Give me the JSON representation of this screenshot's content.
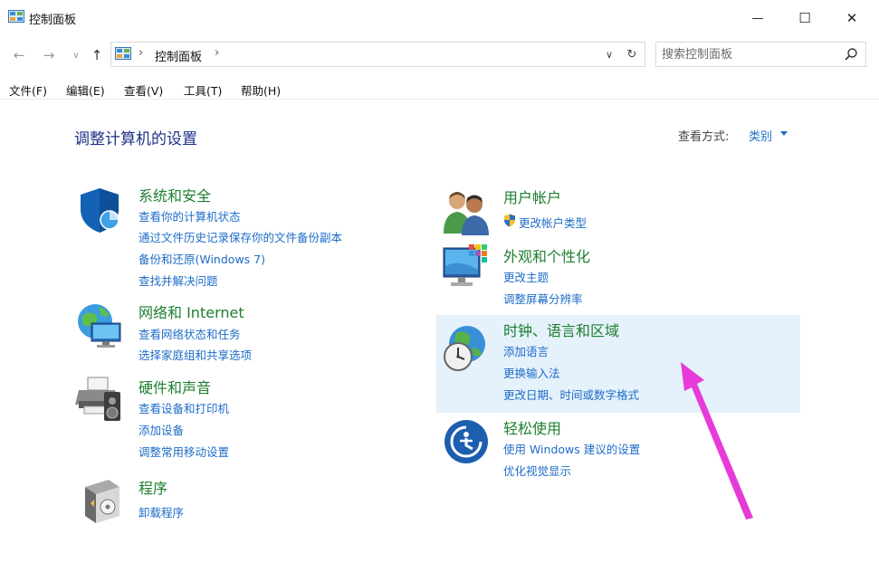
{
  "window": {
    "title": "控制面板",
    "minimize_glyph": "—",
    "maximize_glyph": "☐",
    "close_glyph": "✕"
  },
  "address": {
    "crumb": "控制面板",
    "separator": "›",
    "search_placeholder": "搜索控制面板"
  },
  "menu": [
    "文件(F)",
    "编辑(E)",
    "查看(V)",
    "工具(T)",
    "帮助(H)"
  ],
  "main": {
    "heading": "调整计算机的设置",
    "view_by_label": "查看方式:",
    "view_by_value": "类别"
  },
  "categories": {
    "system_security": {
      "title": "系统和安全",
      "icon": "shield-icon",
      "links": [
        "查看你的计算机状态",
        "通过文件历史记录保存你的文件备份副本",
        "备份和还原(Windows 7)",
        "查找并解决问题"
      ]
    },
    "network": {
      "title": "网络和 Internet",
      "icon": "network-globe-icon",
      "links": [
        "查看网络状态和任务",
        "选择家庭组和共享选项"
      ]
    },
    "hardware": {
      "title": "硬件和声音",
      "icon": "printer-speaker-icon",
      "links": [
        "查看设备和打印机",
        "添加设备",
        "调整常用移动设置"
      ]
    },
    "programs": {
      "title": "程序",
      "icon": "programs-box-icon",
      "links": [
        "卸载程序"
      ]
    },
    "user_accounts": {
      "title": "用户帐户",
      "icon": "users-icon",
      "links": [
        "更改帐户类型"
      ]
    },
    "appearance": {
      "title": "外观和个性化",
      "icon": "monitor-palette-icon",
      "links": [
        "更改主题",
        "调整屏幕分辨率"
      ]
    },
    "clock_region": {
      "title": "时钟、语言和区域",
      "icon": "clock-globe-icon",
      "links": [
        "添加语言",
        "更换输入法",
        "更改日期、时间或数字格式"
      ]
    },
    "ease_of_access": {
      "title": "轻松使用",
      "icon": "ease-of-access-icon",
      "links": [
        "使用 Windows 建议的设置",
        "优化视觉显示"
      ]
    }
  },
  "colors": {
    "category_title": "#1d7f2e",
    "link": "#1e6cc8",
    "heading": "#1e3287",
    "hover_bg": "#e5f1fb",
    "annotation_arrow": "#e63bd8"
  }
}
